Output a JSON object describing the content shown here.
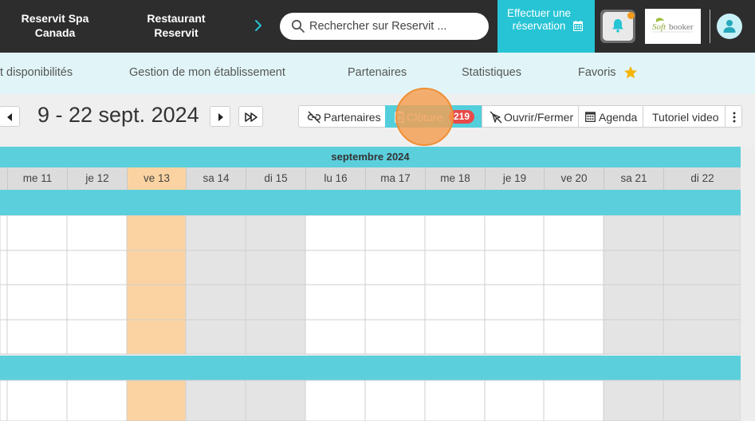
{
  "header": {
    "brand_primary": "Reservit Spa Canada",
    "brand_secondary": "Restaurant Reservit",
    "search_placeholder": "Rechercher sur Reservit ...",
    "reserve_button": "Effectuer une réservation",
    "logo_alt": "Softbooker",
    "icons": [
      "search-icon",
      "calendar-icon",
      "bell-icon",
      "user-icon",
      "chevron-right-icon"
    ]
  },
  "nav": {
    "items": [
      "t disponibilités",
      "Gestion de mon établissement",
      "Partenaires",
      "Statistiques",
      "Favoris"
    ],
    "favorite_icon": "star-icon"
  },
  "toolbar": {
    "date_range": "9 - 22 sept. 2024",
    "partners_label": "Partenaires",
    "closure_label": "Clôture",
    "closure_count": "219",
    "open_close_label": "Ouvrir/Fermer",
    "agenda_label": "Agenda",
    "tutorial_label": "Tutoriel video"
  },
  "calendar": {
    "month_label": "septembre 2024",
    "days": [
      "me 11",
      "je 12",
      "ve 13",
      "sa 14",
      "di 15",
      "lu 16",
      "ma 17",
      "me 18",
      "je 19",
      "ve 20",
      "sa 21",
      "di 22"
    ],
    "today": "ve 13",
    "weekend_days": [
      "sa 14",
      "di 15",
      "sa 21",
      "di 22"
    ]
  },
  "colors": {
    "topbar": "#2d2d2d",
    "accent": "#26c4d4",
    "band": "#5ccfdc",
    "today": "#fbd3a2",
    "weekend": "#e4e4e4",
    "badge": "#e84a4a",
    "highlight": "#f59e50",
    "favorite_star": "#f4b400"
  }
}
